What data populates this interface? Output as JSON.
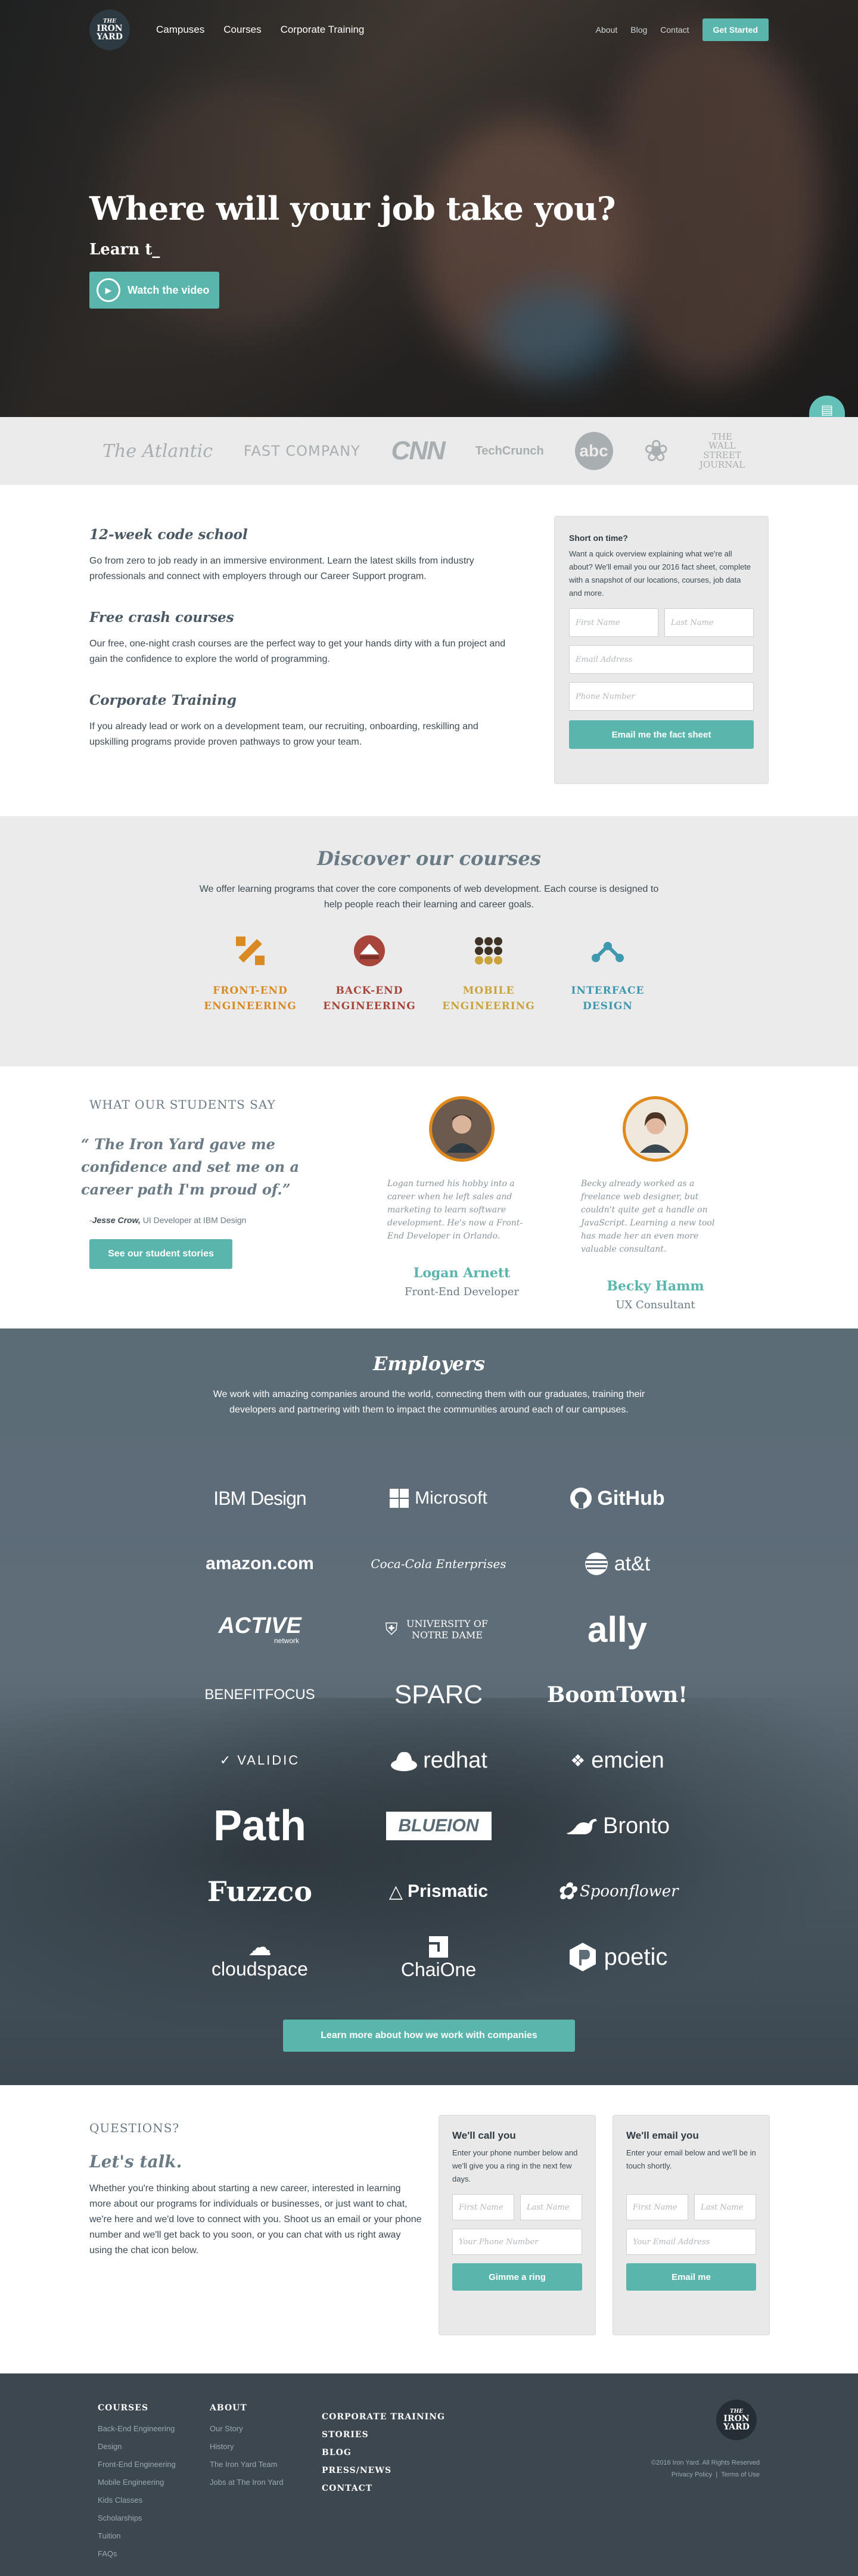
{
  "nav": {
    "logo_top": "THE",
    "logo_line1": "IRON",
    "logo_line2": "YARD",
    "links": [
      "Campuses",
      "Courses",
      "Corporate Training"
    ],
    "small_links": [
      "About",
      "Blog",
      "Contact"
    ],
    "cta": "Get Started"
  },
  "hero": {
    "title": "Where will your job take you?",
    "typed": "Learn t_",
    "watch_label": "Watch the video"
  },
  "press": [
    "The Atlantic",
    "FAST COMPANY",
    "CNN",
    "TechCrunch",
    "abc",
    "NBC",
    "THE WALL STREET JOURNAL"
  ],
  "programs": [
    {
      "title": "12-week code school",
      "text": "Go from zero to job ready in an immersive environment. Learn the latest skills from industry professionals and connect with employers through our Career Support program."
    },
    {
      "title": "Free crash courses",
      "text": "Our free, one-night crash courses are the perfect way to get your hands dirty with a fun project and gain the confidence to explore the world of programming."
    },
    {
      "title": "Corporate Training",
      "text": "If you already lead or work on a development team, our recruiting, onboarding, reskilling and upskilling programs provide proven pathways to grow your team."
    }
  ],
  "fact_sheet": {
    "heading": "Short on time?",
    "text": "Want a quick overview explaining what we're all about? We'll email you our 2016 fact sheet, complete with a snapshot of our locations, courses, job data and more.",
    "first_name": "First Name",
    "last_name": "Last Name",
    "email": "Email Address",
    "phone": "Phone Number",
    "button": "Email me the fact sheet"
  },
  "courses": {
    "title": "Discover our courses",
    "lead": "We offer learning programs that cover the core components of web development. Each course is designed to help people reach their learning and career goals.",
    "items": [
      {
        "line1": "FRONT-END",
        "line2": "ENGINEERING",
        "color": "#d98a22",
        "icon": "front-end-icon"
      },
      {
        "line1": "BACK-END",
        "line2": "ENGINEERING",
        "color": "#a8453a",
        "icon": "back-end-icon"
      },
      {
        "line1": "MOBILE",
        "line2": "ENGINEERING",
        "color": "#c9a43c",
        "icon": "mobile-icon"
      },
      {
        "line1": "INTERFACE",
        "line2": "DESIGN",
        "color": "#3f98ae",
        "icon": "interface-icon"
      }
    ]
  },
  "students": {
    "kicker": "WHAT OUR STUDENTS SAY",
    "quote": "“ The Iron Yard gave me confidence and set me on a career path I'm proud of.”",
    "cite_name": "Jesse Crow,",
    "cite_role": "UI Developer at IBM Design",
    "cite_dash": "-",
    "button": "See our student stories",
    "profiles": [
      {
        "name": "Logan Arnett",
        "role": "Front-End Developer",
        "bio": "Logan turned his hobby into a career when he left sales and marketing to learn software development. He's now a Front-End Developer in Orlando."
      },
      {
        "name": "Becky Hamm",
        "role": "UX Consultant",
        "bio": "Becky already worked as a freelance web designer, but couldn't quite get a handle on JavaScript. Learning a new tool has made her an even more valuable consultant."
      }
    ]
  },
  "employers": {
    "title": "Employers",
    "lead": "We work with amazing companies around the world, connecting them with our graduates, training their developers and partnering with them to impact the communities around each of our campuses.",
    "logos": [
      "IBM Design",
      "Microsoft",
      "GitHub",
      "amazon.com",
      "Coca-Cola Enterprises",
      "at&t",
      "ACTIVE",
      "UNIVERSITY OF NOTRE DAME",
      "ally",
      "BENEFITFOCUS",
      "SPARC",
      "BoomTown!",
      "VALIDIC",
      "redhat",
      "emcien",
      "Path",
      "BLUEION",
      "Bronto",
      "Fuzzco",
      "Prismatic",
      "Spoonflower",
      "cloudspace",
      "ChaiOne",
      "poetic"
    ],
    "active_sub": "network",
    "button": "Learn more about how we work with companies"
  },
  "questions": {
    "kicker": "QUESTIONS?",
    "title": "Let's talk.",
    "text": "Whether you're thinking about starting a new career, interested in learning more about our programs for individuals or businesses, or just want to chat, we're here and we'd love to connect with you. Shoot us an email or your phone number and we'll get back to you soon, or you can chat with us right away using the chat icon below.",
    "call": {
      "heading": "We'll call you",
      "text": "Enter your phone number below and we'll give you a ring in the next few days.",
      "first_name": "First Name",
      "last_name": "Last Name",
      "phone": "Your Phone Number",
      "button": "Gimme a ring"
    },
    "email": {
      "heading": "We'll email you",
      "text": "Enter your email below and we'll be in touch shortly.",
      "first_name": "First Name",
      "last_name": "Last Name",
      "email": "Your Email Address",
      "button": "Email me"
    }
  },
  "footer": {
    "courses_head": "COURSES",
    "courses": [
      "Back-End Engineering",
      "Design",
      "Front-End Engineering",
      "Mobile Engineering",
      "Kids Classes",
      "Scholarships",
      "Tuition",
      "FAQs"
    ],
    "about_head": "ABOUT",
    "about": [
      "Our Story",
      "History",
      "The Iron Yard Team",
      "Jobs at The Iron Yard"
    ],
    "bold_links": [
      "CORPORATE TRAINING",
      "STORIES",
      "BLOG",
      "PRESS/NEWS",
      "CONTACT"
    ],
    "copyright": "©2016 Iron Yard. All Rights Reserved",
    "privacy": "Privacy Policy",
    "separator": "|",
    "terms": "Terms of Use"
  }
}
